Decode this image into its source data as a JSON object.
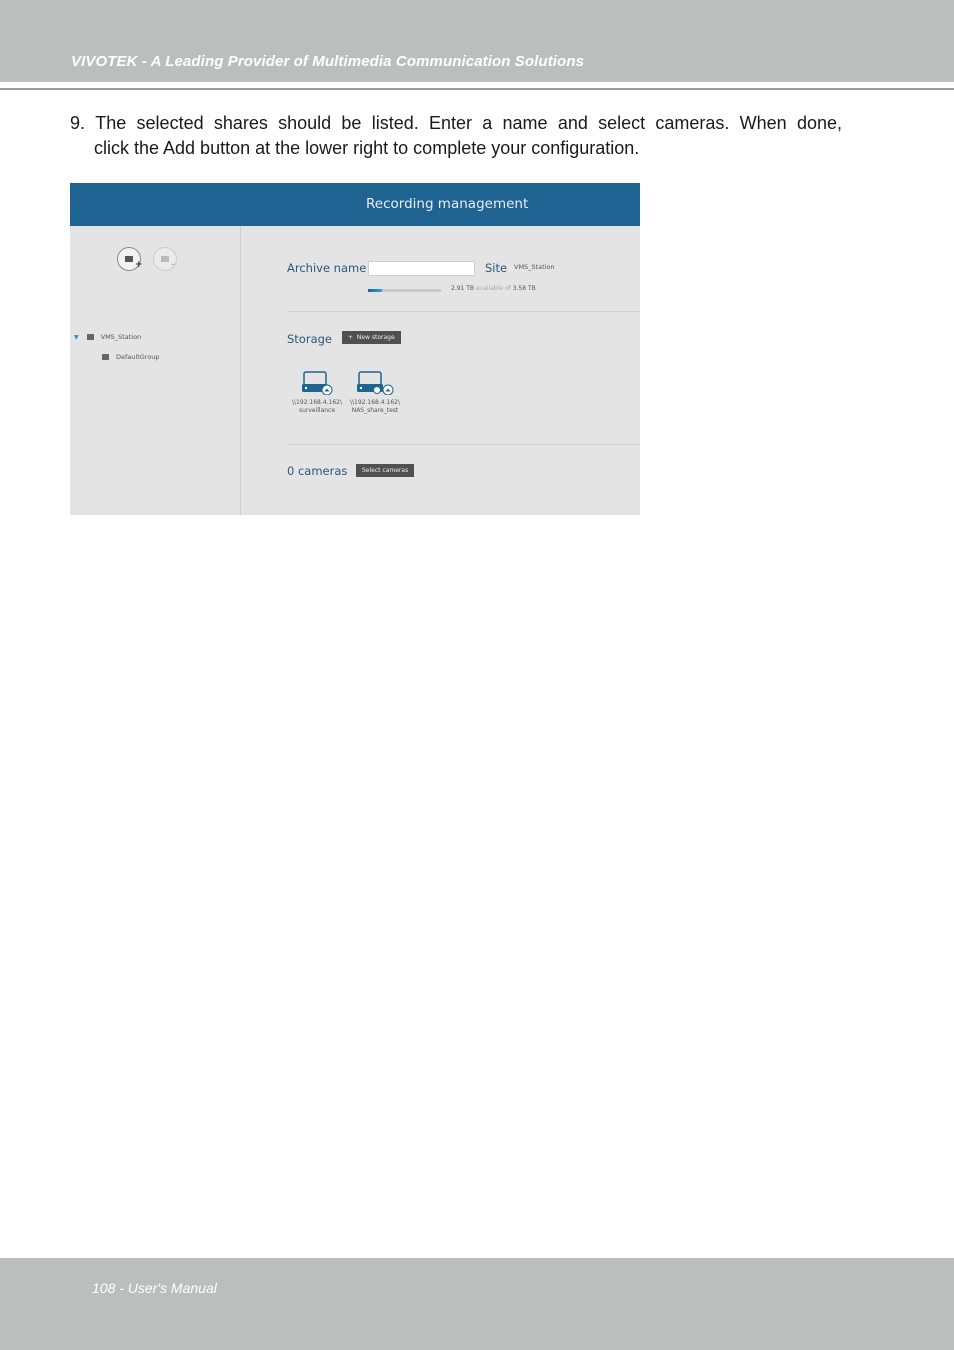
{
  "header": {
    "title": "VIVOTEK - A Leading Provider of Multimedia Communication Solutions"
  },
  "step": {
    "line1_words": [
      "9.",
      "The",
      "selected",
      "shares",
      "should",
      "be",
      "listed.",
      "Enter",
      "a",
      "name",
      "and",
      "select",
      "cameras.",
      "When",
      "done,"
    ],
    "line2": "click the Add button at the lower right to complete your configuration."
  },
  "screenshot": {
    "window_title": "Recording management",
    "tree": {
      "station": "VMS_Station",
      "group": "DefaultGroup"
    },
    "archive": {
      "name_label": "Archive name",
      "name_value": "",
      "site_label": "Site",
      "site_value": "VMS_Station",
      "free": "2.91 TB",
      "available_of": "available of",
      "total": "3.58 TB",
      "used_fraction": 0.19
    },
    "storage": {
      "label": "Storage",
      "new_button": "New storage",
      "new_button_icon": "plus-icon",
      "shares": [
        {
          "host": "\\\\192.168.4.162\\",
          "name": "surveillance",
          "icon": "nas-share-icon"
        },
        {
          "host": "\\\\192.168.4.162\\",
          "name": "NAS_share_test",
          "icon": "nas-share-icon"
        }
      ]
    },
    "cameras": {
      "label": "0 cameras",
      "select_button": "Select cameras"
    },
    "colors": {
      "title_bar": "#1e6391",
      "label_text": "#2a5778",
      "tree_caret": "#2f89c5"
    }
  },
  "footer": {
    "page": "108 - User's Manual"
  }
}
